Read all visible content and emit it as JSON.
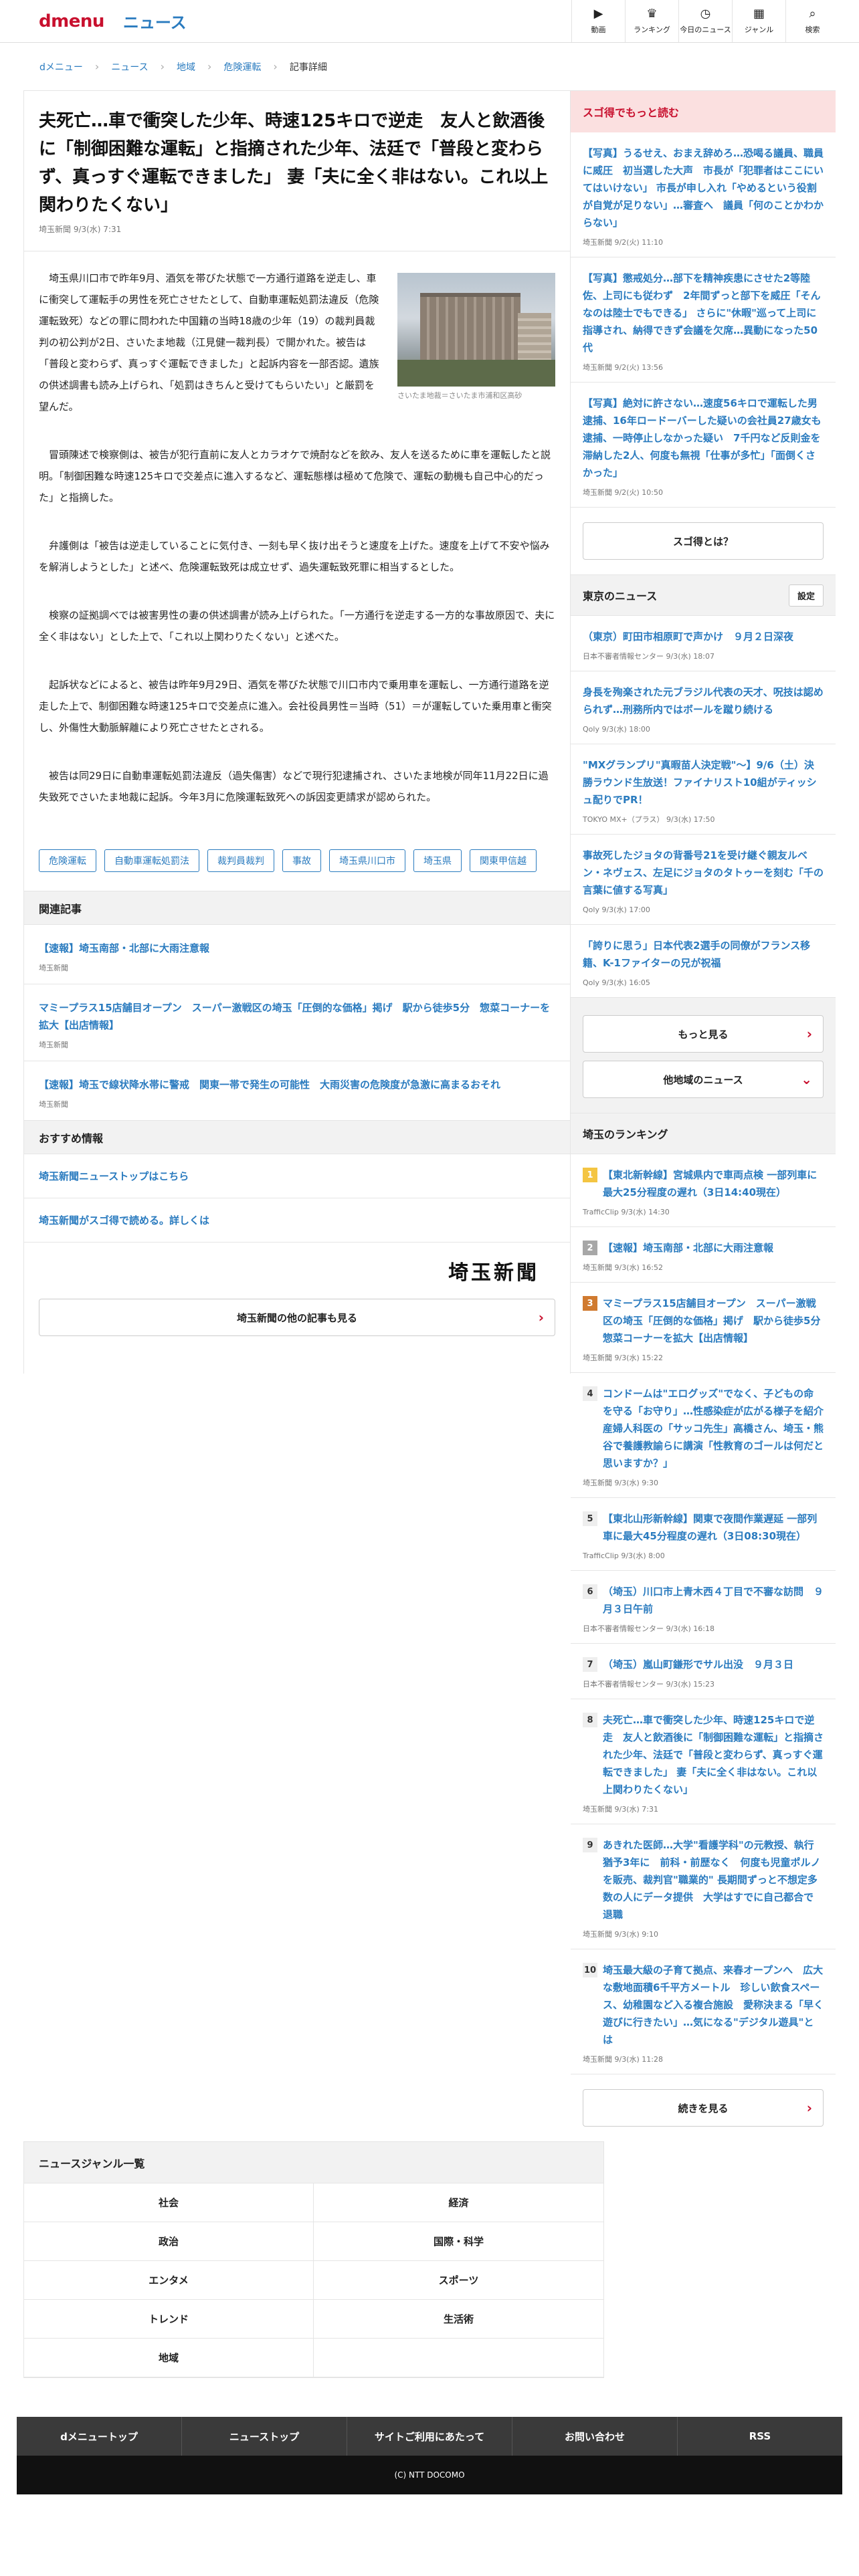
{
  "header": {
    "brand_dmenu": "dmenu",
    "brand_news": "ニュース",
    "nav": [
      {
        "icon": "video-icon",
        "glyph": "▶",
        "label": "動画"
      },
      {
        "icon": "trophy-icon",
        "glyph": "♛",
        "label": "ランキング"
      },
      {
        "icon": "clock-icon",
        "glyph": "◷",
        "label": "今日のニュース"
      },
      {
        "icon": "grid-icon",
        "glyph": "▦",
        "label": "ジャンル"
      },
      {
        "icon": "search-icon",
        "glyph": "⌕",
        "label": "検索"
      }
    ]
  },
  "breadcrumb": [
    "dメニュー",
    "ニュース",
    "地域",
    "危険運転",
    "記事詳細"
  ],
  "article": {
    "title": "夫死亡…車で衝突した少年、時速125キロで逆走　友人と飲酒後に「制御困難な運転」と指摘された少年、法廷で「普段と変わらず、真っすぐ運転できました」 妻「夫に全く非はない。これ以上関わりたくない」",
    "meta": "埼玉新聞 9/3(水) 7:31",
    "photo_caption": "さいたま地裁＝さいたま市浦和区高砂",
    "paragraphs": [
      "埼玉県川口市で昨年9月、酒気を帯びた状態で一方通行道路を逆走し、車に衝突して運転手の男性を死亡させたとして、自動車運転処罰法違反（危険運転致死）などの罪に問われた中国籍の当時18歳の少年（19）の裁判員裁判の初公判が2日、さいたま地裁（江見健一裁判長）で開かれた。被告は「普段と変わらず、真っすぐ運転できました」と起訴内容を一部否認。遺族の供述調書も読み上げられ、「処罰はきちんと受けてもらいたい」と厳罰を望んだ。",
      "冒頭陳述で検察側は、被告が犯行直前に友人とカラオケで焼酎などを飲み、友人を送るために車を運転したと説明。「制御困難な時速125キロで交差点に進入するなど、運転態様は極めて危険で、運転の動機も自己中心的だった」と指摘した。",
      "弁護側は「被告は逆走していることに気付き、一刻も早く抜け出そうと速度を上げた。速度を上げて不安や悩みを解消しようとした」と述べ、危険運転致死は成立せず、過失運転致死罪に相当するとした。",
      "検察の証拠調べでは被害男性の妻の供述調書が読み上げられた。「一方通行を逆走する一方的な事故原因で、夫に全く非はない」とした上で、「これ以上関わりたくない」と述べた。",
      "起訴状などによると、被告は昨年9月29日、酒気を帯びた状態で川口市内で乗用車を運転し、一方通行道路を逆走した上で、制御困難な時速125キロで交差点に進入。会社役員男性＝当時（51）＝が運転していた乗用車と衝突し、外傷性大動脈解離により死亡させたとされる。",
      "被告は同29日に自動車運転処罰法違反（過失傷害）などで現行犯逮捕され、さいたま地検が同年11月22日に過失致死でさいたま地裁に起訴。今年3月に危険運転致死への訴因変更請求が認められた。"
    ],
    "tags": [
      "危険運転",
      "自動車運転処罰法",
      "裁判員裁判",
      "事故",
      "埼玉県川口市",
      "埼玉県",
      "関東甲信越"
    ]
  },
  "related": {
    "heading": "関連記事",
    "items": [
      {
        "title": "【速報】埼玉南部・北部に大雨注意報",
        "source": "埼玉新聞"
      },
      {
        "title": "マミープラス15店舗目オープン　スーパー激戦区の埼玉「圧倒的な価格」掲げ　駅から徒歩5分　惣菜コーナーを拡大【出店情報】",
        "source": "埼玉新聞"
      },
      {
        "title": "【速報】埼玉で線状降水帯に警戒　関東一帯で発生の可能性　大雨災害の危険度が急激に高まるおそれ",
        "source": "埼玉新聞"
      }
    ]
  },
  "recommend": {
    "heading": "おすすめ情報",
    "items": [
      "埼玉新聞ニューストップはこちら",
      "埼玉新聞がスゴ得で読める。詳しくは"
    ],
    "logo_text": "埼玉新聞",
    "more_button": "埼玉新聞の他の記事も見る"
  },
  "side_sugotoku": {
    "heading": "スゴ得でもっと読む",
    "items": [
      {
        "title": "【写真】うるせえ、おまえ辞めろ…恐喝る議員、職員に威圧　初当選した大声　市長が「犯罪者はここにいてはいけない」 市長が申し入れ「やめるという役割が自覚が足りない」…審査へ　議員「何のことかわからない」",
        "source": "埼玉新聞 9/2(火) 11:10"
      },
      {
        "title": "【写真】懲戒処分…部下を精神疾患にさせた2等陸佐、上司にも従わず　2年間ずっと部下を威圧「そんなのは陸士でもできる」 さらに\"休暇\"巡って上司に指導され、納得できず会議を欠席…異動になった50代",
        "source": "埼玉新聞 9/2(火) 13:56"
      },
      {
        "title": "【写真】絶対に許さない…速度56キロで運転した男逮捕、16年ロードーバーした疑いの会社員27歳女も逮捕、一時停止しなかった疑い　7千円など反則金を滞納した2人、何度も無視「仕事が多忙」「面倒くさかった」",
        "source": "埼玉新聞 9/2(火) 10:50"
      }
    ],
    "button": "スゴ得とは？"
  },
  "side_tokyo": {
    "heading": "東京のニュース",
    "settings": "設定",
    "items": [
      {
        "title": "（東京）町田市相原町で声かけ　９月２日深夜",
        "source": "日本不審者情報センター 9/3(水) 18:07"
      },
      {
        "title": "身長を殉楽された元ブラジル代表の天才、呪技は認められず…刑務所内ではボールを蹴り続ける",
        "source": "Qoly 9/3(水) 18:00"
      },
      {
        "title": "\"MXグランプリ\"真暇苗人決定戦\"〜】9/6（土）決勝ラウンド生放送！ファイナリスト10組がティッシュ配りでPR！",
        "source": "TOKYO MX+（プラス） 9/3(水) 17:50"
      },
      {
        "title": "事故死したジョタの背番号21を受け継ぐ親友ルベン・ネヴェス、左足にジョタのタトゥーを刻む「千の言葉に値する写真」",
        "source": "Qoly 9/3(水) 17:00"
      },
      {
        "title": "「誇りに思う」日本代表2選手の同僚がフランス移籍、K-1ファイターの兄が祝福",
        "source": "Qoly 9/3(水) 16:05"
      }
    ],
    "more_button": "もっと見る",
    "other_region": "他地域のニュース"
  },
  "side_ranking": {
    "heading": "埼玉のランキング",
    "items": [
      {
        "rank": "1",
        "title": "【東北新幹線】宮城県内で車両点検 一部列車に最大25分程度の遅れ（3日14:40現在）",
        "source": "TrafficClip 9/3(水) 14:30"
      },
      {
        "rank": "2",
        "title": "【速報】埼玉南部・北部に大雨注意報",
        "source": "埼玉新聞 9/3(水) 16:52"
      },
      {
        "rank": "3",
        "title": "マミープラス15店舗目オープン　スーパー激戦区の埼玉「圧倒的な価格」掲げ　駅から徒歩5分　惣菜コーナーを拡大【出店情報】",
        "source": "埼玉新聞 9/3(水) 15:22"
      },
      {
        "rank": "4",
        "title": "コンドームは\"エログッズ\"でなく、子どもの命を守る「お守り」…性感染症が広がる様子を紹介　産婦人科医の「サッコ先生」高橋さん、埼玉・熊谷で養護教諭らに講演「性教育のゴールは何だと思いますか？」",
        "source": "埼玉新聞 9/3(水) 9:30"
      },
      {
        "rank": "5",
        "title": "【東北山形新幹線】関東で夜間作業遅延 一部列車に最大45分程度の遅れ（3日08:30現在）",
        "source": "TrafficClip 9/3(水) 8:00"
      },
      {
        "rank": "6",
        "title": "（埼玉）川口市上青木西４丁目で不審な訪問　９月３日午前",
        "source": "日本不審者情報センター 9/3(水) 16:18"
      },
      {
        "rank": "7",
        "title": "（埼玉）嵐山町鎌形でサル出没　９月３日",
        "source": "日本不審者情報センター 9/3(水) 15:23"
      },
      {
        "rank": "8",
        "title": "夫死亡…車で衝突した少年、時速125キロで逆走　友人と飲酒後に「制御困難な運転」と指摘された少年、法廷で「普段と変わらず、真っすぐ運転できました」 妻「夫に全く非はない。これ以上関わりたくない」",
        "source": "埼玉新聞 9/3(水) 7:31"
      },
      {
        "rank": "9",
        "title": "あきれた医師…大学\"看護学科\"の元教授、執行猶予3年に　前科・前歴なく　何度も児童ポルノを販売、裁判官\"職業的\" 長期間ずっと不想定多数の人にデータ提供　大学はすでに自己都合で退職",
        "source": "埼玉新聞 9/3(水) 9:10"
      },
      {
        "rank": "10",
        "title": "埼玉最大級の子育て拠点、来春オープンへ　広大な敷地面積6千平方メートル　珍しい飲食スペース、幼稚園など入る複合施設　愛称決まる「早く遊びに行きたい」…気になる\"デジタル遊具\"とは",
        "source": "埼玉新聞 9/3(水) 11:28"
      }
    ],
    "more_button": "続きを見る"
  },
  "genre": {
    "heading": "ニュースジャンル一覧",
    "items": [
      "社会",
      "経済",
      "政治",
      "国際・科学",
      "エンタメ",
      "スポーツ",
      "トレンド",
      "生活術",
      "地域",
      ""
    ]
  },
  "footer": {
    "nav": [
      "dメニュートップ",
      "ニューストップ",
      "サイトご利用にあたって",
      "お問い合わせ",
      "RSS"
    ],
    "copyright": "(C) NTT DOCOMO"
  }
}
